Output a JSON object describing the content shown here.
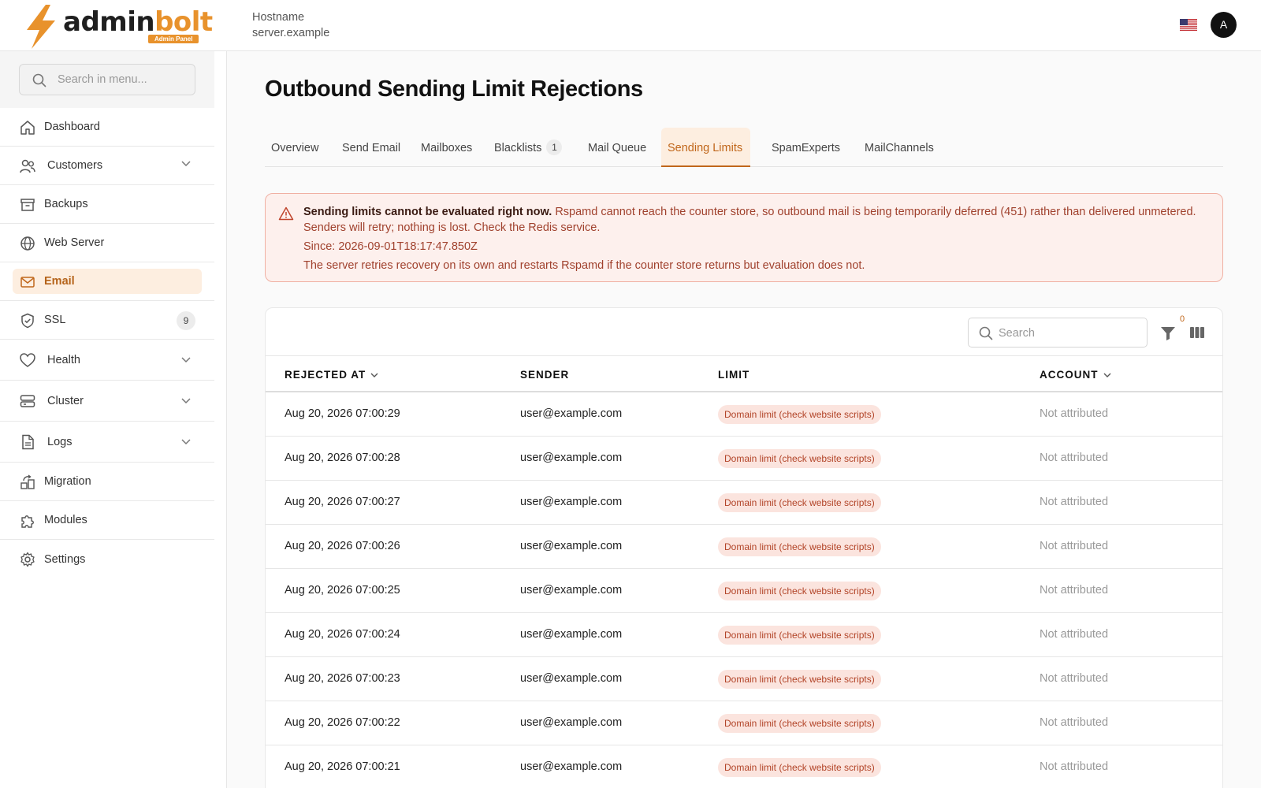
{
  "brand": {
    "name_a": "admin",
    "name_b": "bolt",
    "badge": "Admin Panel",
    "accent": "#e8922c"
  },
  "header": {
    "hostname_label": "Hostname",
    "hostname_value": "server.example",
    "avatar_letter": "A",
    "language_flag": "us-flag-icon"
  },
  "sidebar": {
    "search_placeholder": "Search in menu...",
    "items": [
      {
        "label": "Dashboard",
        "icon": "home-icon"
      },
      {
        "label": "Customers",
        "icon": "users-icon",
        "expandable": true
      },
      {
        "label": "Backups",
        "icon": "archive-icon"
      },
      {
        "label": "Web Server",
        "icon": "globe-icon"
      },
      {
        "label": "Email",
        "icon": "mail-icon",
        "active": true
      },
      {
        "label": "SSL",
        "icon": "shield-icon",
        "count": "9"
      },
      {
        "label": "Health",
        "icon": "heart-icon",
        "expandable": true
      },
      {
        "label": "Cluster",
        "icon": "server-icon",
        "expandable": true
      },
      {
        "label": "Logs",
        "icon": "file-icon",
        "expandable": true
      },
      {
        "label": "Migration",
        "icon": "migration-icon"
      },
      {
        "label": "Modules",
        "icon": "puzzle-icon"
      },
      {
        "label": "Settings",
        "icon": "gear-icon"
      }
    ]
  },
  "page": {
    "title": "Outbound Sending Limit Rejections"
  },
  "tabs": [
    {
      "label": "Overview"
    },
    {
      "label": "Send Email"
    },
    {
      "label": "Mailboxes"
    },
    {
      "label": "Blacklists",
      "badge": "1"
    },
    {
      "label": "Mail Queue"
    },
    {
      "label": "Sending Limits",
      "active": true
    },
    {
      "label": "SpamExperts"
    },
    {
      "label": "MailChannels"
    }
  ],
  "alert": {
    "title": "Sending limits cannot be evaluated right now.",
    "message": "Rspamd cannot reach the counter store, so outbound mail is being temporarily deferred (451) rather than delivered unmetered. Senders will retry; nothing is lost. Check the Redis service.",
    "since": "Since: 2026-09-01T18:17:47.850Z",
    "note": "The server retries recovery on its own and restarts Rspamd if the counter store returns but evaluation does not."
  },
  "table": {
    "search_placeholder": "Search",
    "filter_count": "0",
    "columns": {
      "rejected_at": "REJECTED AT",
      "sender": "SENDER",
      "limit": "LIMIT",
      "account": "ACCOUNT"
    },
    "rows": [
      {
        "rejected_at": "Aug 20, 2026 07:00:29",
        "sender": "user@example.com",
        "limit": "Domain limit (check website scripts)",
        "account": "Not attributed"
      },
      {
        "rejected_at": "Aug 20, 2026 07:00:28",
        "sender": "user@example.com",
        "limit": "Domain limit (check website scripts)",
        "account": "Not attributed"
      },
      {
        "rejected_at": "Aug 20, 2026 07:00:27",
        "sender": "user@example.com",
        "limit": "Domain limit (check website scripts)",
        "account": "Not attributed"
      },
      {
        "rejected_at": "Aug 20, 2026 07:00:26",
        "sender": "user@example.com",
        "limit": "Domain limit (check website scripts)",
        "account": "Not attributed"
      },
      {
        "rejected_at": "Aug 20, 2026 07:00:25",
        "sender": "user@example.com",
        "limit": "Domain limit (check website scripts)",
        "account": "Not attributed"
      },
      {
        "rejected_at": "Aug 20, 2026 07:00:24",
        "sender": "user@example.com",
        "limit": "Domain limit (check website scripts)",
        "account": "Not attributed"
      },
      {
        "rejected_at": "Aug 20, 2026 07:00:23",
        "sender": "user@example.com",
        "limit": "Domain limit (check website scripts)",
        "account": "Not attributed"
      },
      {
        "rejected_at": "Aug 20, 2026 07:00:22",
        "sender": "user@example.com",
        "limit": "Domain limit (check website scripts)",
        "account": "Not attributed"
      },
      {
        "rejected_at": "Aug 20, 2026 07:00:21",
        "sender": "user@example.com",
        "limit": "Domain limit (check website scripts)",
        "account": "Not attributed"
      }
    ]
  }
}
